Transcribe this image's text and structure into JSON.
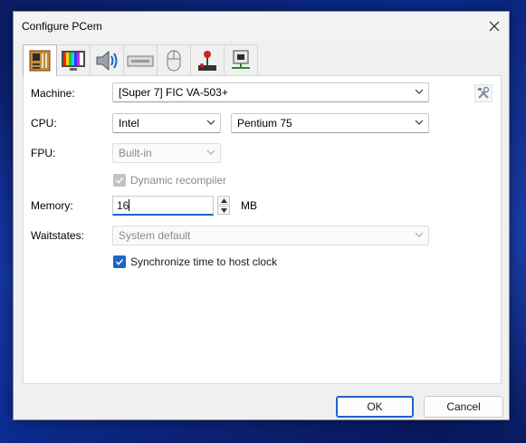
{
  "window": {
    "title": "Configure PCem"
  },
  "tabs": [
    {
      "icon": "motherboard-icon"
    },
    {
      "icon": "monitor-icon"
    },
    {
      "icon": "speaker-icon"
    },
    {
      "icon": "drive-icon"
    },
    {
      "icon": "mouse-icon"
    },
    {
      "icon": "joystick-icon"
    },
    {
      "icon": "network-icon"
    }
  ],
  "machine": {
    "label": "Machine:",
    "value": "[Super 7] FIC VA-503+"
  },
  "cpu": {
    "label": "CPU:",
    "manufacturer": "Intel",
    "model": "Pentium 75"
  },
  "fpu": {
    "label": "FPU:",
    "value": "Built-in"
  },
  "dynarec": {
    "label": "Dynamic recompiler",
    "checked": true,
    "disabled": true
  },
  "memory": {
    "label": "Memory:",
    "value": "16",
    "unit": "MB"
  },
  "waitstates": {
    "label": "Waitstates:",
    "value": "System default"
  },
  "sync_time": {
    "label": "Synchronize time to host clock",
    "checked": true
  },
  "buttons": {
    "ok": "OK",
    "cancel": "Cancel"
  }
}
